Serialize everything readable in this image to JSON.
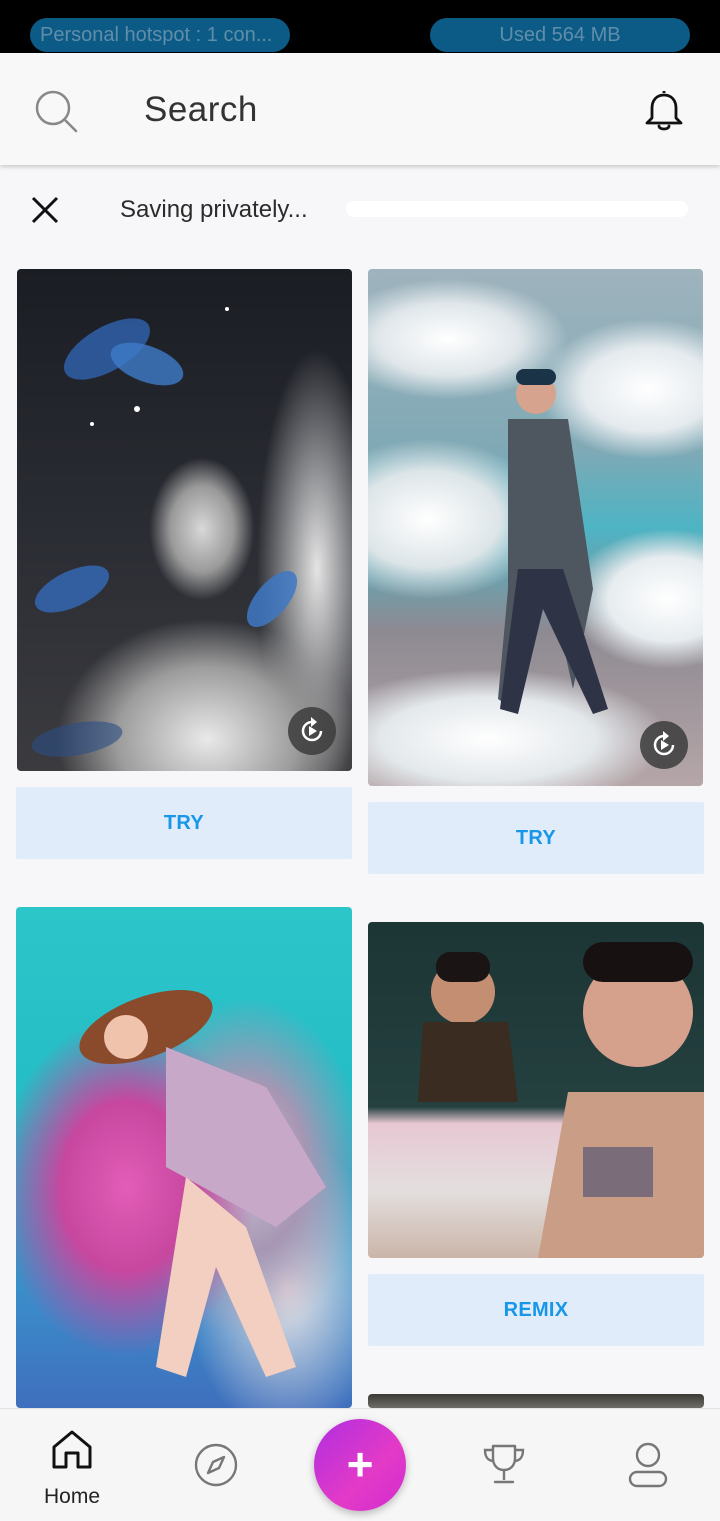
{
  "status_bar": {
    "hotspot_text": "Personal hotspot : 1 con...",
    "data_used_text": "Used  564 MB"
  },
  "header": {
    "search_placeholder": "Search",
    "search_icon": "search-icon",
    "notification_icon": "bell-icon"
  },
  "saving": {
    "text": "Saving privately...",
    "progress": 0
  },
  "feed": {
    "cards": [
      {
        "description": "black and white portrait with blue butterflies",
        "button_label": "TRY",
        "replay_icon": "replay-icon"
      },
      {
        "description": "man walking among clouds",
        "button_label": "TRY",
        "replay_icon": "replay-icon"
      },
      {
        "description": "woman lying on pink and teal background"
      },
      {
        "description": "two women with jewelry mirror scene",
        "button_label": "REMIX"
      },
      {
        "description": "partial image"
      }
    ]
  },
  "bottom_nav": {
    "home_label": "Home",
    "items": [
      "home-icon",
      "explore-icon",
      "add-icon",
      "trophy-icon",
      "profile-icon"
    ],
    "fab_label": "+"
  },
  "colors": {
    "accent": "#1797e8",
    "button_bg": "#e1ecfb",
    "fab_start": "#b02ee0",
    "fab_end": "#e33ac7"
  }
}
